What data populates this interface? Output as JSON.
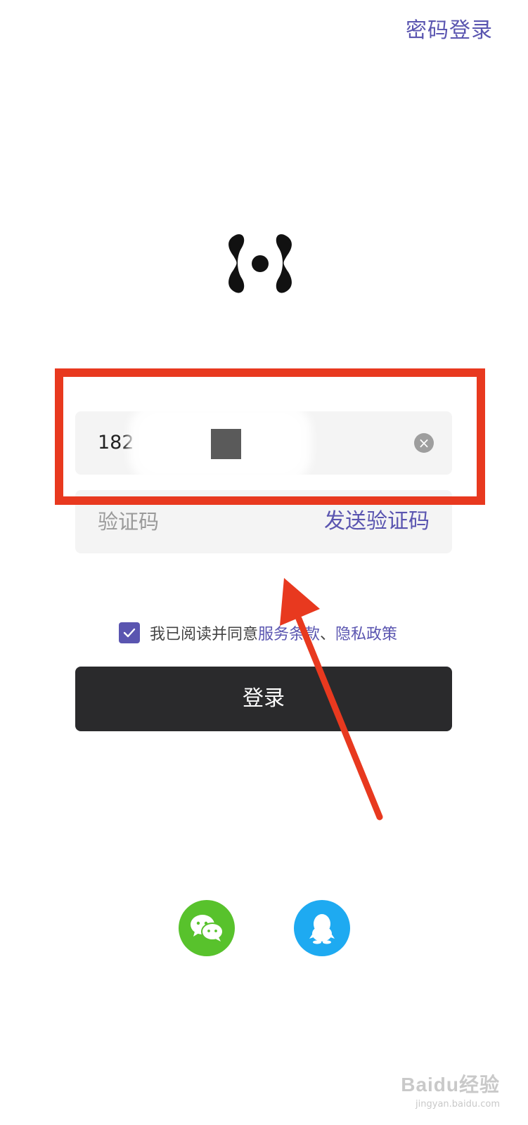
{
  "header": {
    "password_login": "密码登录"
  },
  "logo": {
    "icon": "app-logo-icon"
  },
  "phone_field": {
    "value": "182",
    "clear_icon": "close-icon"
  },
  "code_field": {
    "placeholder": "验证码",
    "send_code_label": "发送验证码"
  },
  "agreement": {
    "checked": true,
    "prefix": "我已阅读并同意",
    "terms": "服务条款",
    "separator": "、",
    "privacy": "隐私政策"
  },
  "login_button": {
    "label": "登录"
  },
  "social": {
    "wechat_icon": "wechat-icon",
    "qq_icon": "qq-icon"
  },
  "watermark": {
    "main": "Baidu经验",
    "sub": "jingyan.baidu.com"
  },
  "colors": {
    "accent": "#5a55b0",
    "highlight": "#e8391f",
    "button": "#2a2a2c",
    "wechat": "#58c22c",
    "qq": "#1eaaf1"
  }
}
